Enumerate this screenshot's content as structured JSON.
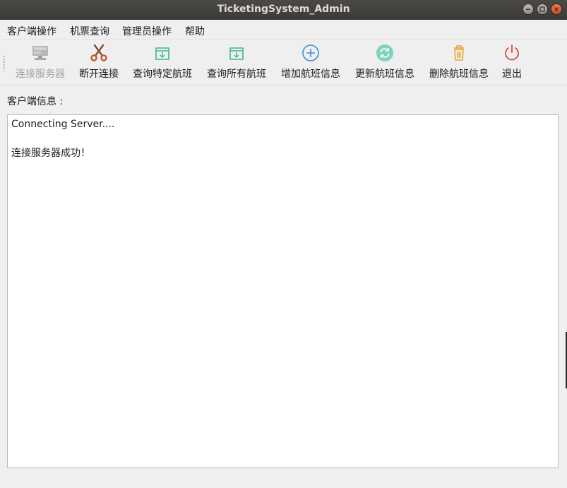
{
  "window": {
    "title": "TicketingSystem_Admin"
  },
  "menubar": {
    "items": [
      {
        "label": "客户端操作"
      },
      {
        "label": "机票查询"
      },
      {
        "label": "管理员操作"
      },
      {
        "label": "帮助"
      }
    ]
  },
  "toolbar": {
    "buttons": [
      {
        "label": "连接服务器",
        "icon": "server-icon",
        "enabled": false
      },
      {
        "label": "断开连接",
        "icon": "scissors-icon",
        "enabled": true
      },
      {
        "label": "查询特定航班",
        "icon": "download-box-icon",
        "enabled": true
      },
      {
        "label": "查询所有航班",
        "icon": "download-box-icon",
        "enabled": true
      },
      {
        "label": "增加航班信息",
        "icon": "plus-circle-icon",
        "enabled": true
      },
      {
        "label": "更新航班信息",
        "icon": "refresh-icon",
        "enabled": true
      },
      {
        "label": "删除航班信息",
        "icon": "trash-icon",
        "enabled": true
      },
      {
        "label": "退出",
        "icon": "power-icon",
        "enabled": true
      }
    ]
  },
  "main": {
    "info_label": "客户端信息 :",
    "log": [
      "Connecting Server....",
      "",
      "连接服务器成功！"
    ]
  },
  "colors": {
    "titlebar": "#3c3b37",
    "close_button": "#dd4814",
    "green_icon": "#3fb68b",
    "blue_icon": "#3a8fd8",
    "orange_icon": "#f0a030",
    "red_icon": "#e04a3a"
  }
}
